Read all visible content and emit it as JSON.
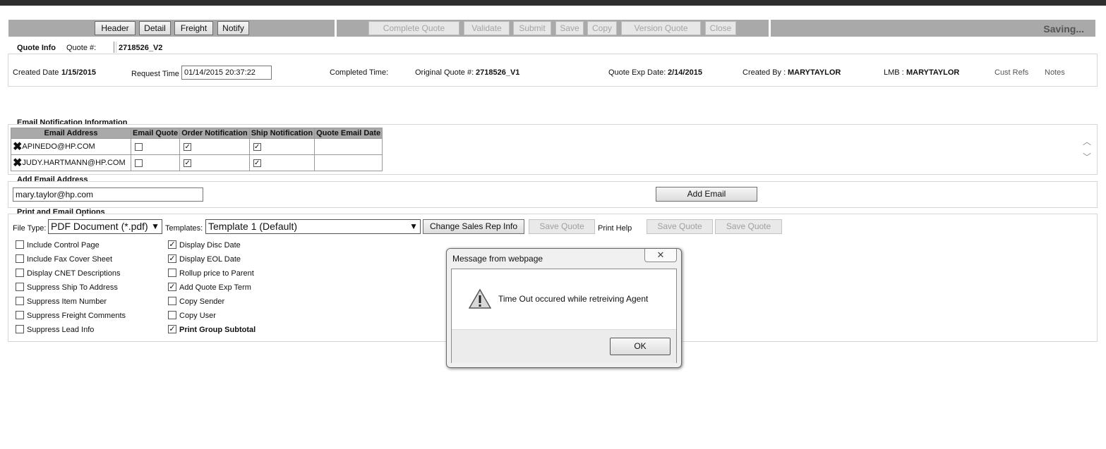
{
  "toolbar": {
    "nav_buttons": [
      "Header",
      "Detail",
      "Freight",
      "Notify"
    ],
    "action_buttons": [
      "Complete Quote",
      "Validate",
      "Submit",
      "Save",
      "Copy",
      "Version Quote",
      "Close"
    ],
    "status": "Saving..."
  },
  "quote_info": {
    "tab_label": "Quote Info",
    "quote_num_label": "Quote #:",
    "quote_num": "2718526_V2",
    "created_date_label": "Created Date",
    "created_date": "1/15/2015",
    "request_time_label": "Request Time",
    "request_time": "01/14/2015 20:37:22",
    "completed_time_label": "Completed Time:",
    "original_quote_label": "Original Quote #:",
    "original_quote": "2718526_V1",
    "exp_date_label": "Quote Exp Date:",
    "exp_date": "2/14/2015",
    "created_by_label": "Created By :",
    "created_by": "MARYTAYLOR",
    "lmb_label": "LMB :",
    "lmb": "MARYTAYLOR",
    "cust_refs": "Cust Refs",
    "notes": "Notes"
  },
  "email_notification": {
    "title": "Email Notification Information",
    "columns": [
      "Email Address",
      "Email Quote",
      "Order Notification",
      "Ship Notification",
      "Quote Email Date"
    ],
    "rows": [
      {
        "email": "APINEDO@HP.COM",
        "email_quote": false,
        "order_notification": true,
        "ship_notification": true,
        "quote_email_date": ""
      },
      {
        "email": "JUDY.HARTMANN@HP.COM",
        "email_quote": false,
        "order_notification": true,
        "ship_notification": true,
        "quote_email_date": ""
      }
    ]
  },
  "add_email": {
    "title": "Add Email Address",
    "value": "mary.taylor@hp.com",
    "button": "Add Email"
  },
  "print_options": {
    "title": "Print and Email Options",
    "file_type_label": "File Type:",
    "file_type": "PDF Document (*.pdf)",
    "templates_label": "Templates:",
    "template": "Template 1 (Default)",
    "change_rep_button": "Change Sales Rep Info",
    "save_quote_button": "Save Quote",
    "print_help": "Print Help",
    "col1": [
      {
        "label": "Include Control Page",
        "checked": false
      },
      {
        "label": "Include Fax Cover Sheet",
        "checked": false
      },
      {
        "label": "Display CNET Descriptions",
        "checked": false
      },
      {
        "label": "Suppress Ship To Address",
        "checked": false
      },
      {
        "label": "Suppress Item Number",
        "checked": false
      },
      {
        "label": "Suppress Freight Comments",
        "checked": false
      },
      {
        "label": "Suppress Lead Info",
        "checked": false
      }
    ],
    "col2": [
      {
        "label": "Display Disc Date",
        "checked": true
      },
      {
        "label": "Display EOL Date",
        "checked": true
      },
      {
        "label": "Rollup price to Parent",
        "checked": false
      },
      {
        "label": "Add Quote Exp Term",
        "checked": true
      },
      {
        "label": "Copy Sender",
        "checked": false
      },
      {
        "label": "Copy User",
        "checked": false
      },
      {
        "label": "Print Group Subtotal",
        "checked": true
      }
    ]
  },
  "dialog": {
    "title": "Message from webpage",
    "message": "Time Out occured while retreiving Agent",
    "ok": "OK",
    "icon": "warning-icon"
  }
}
